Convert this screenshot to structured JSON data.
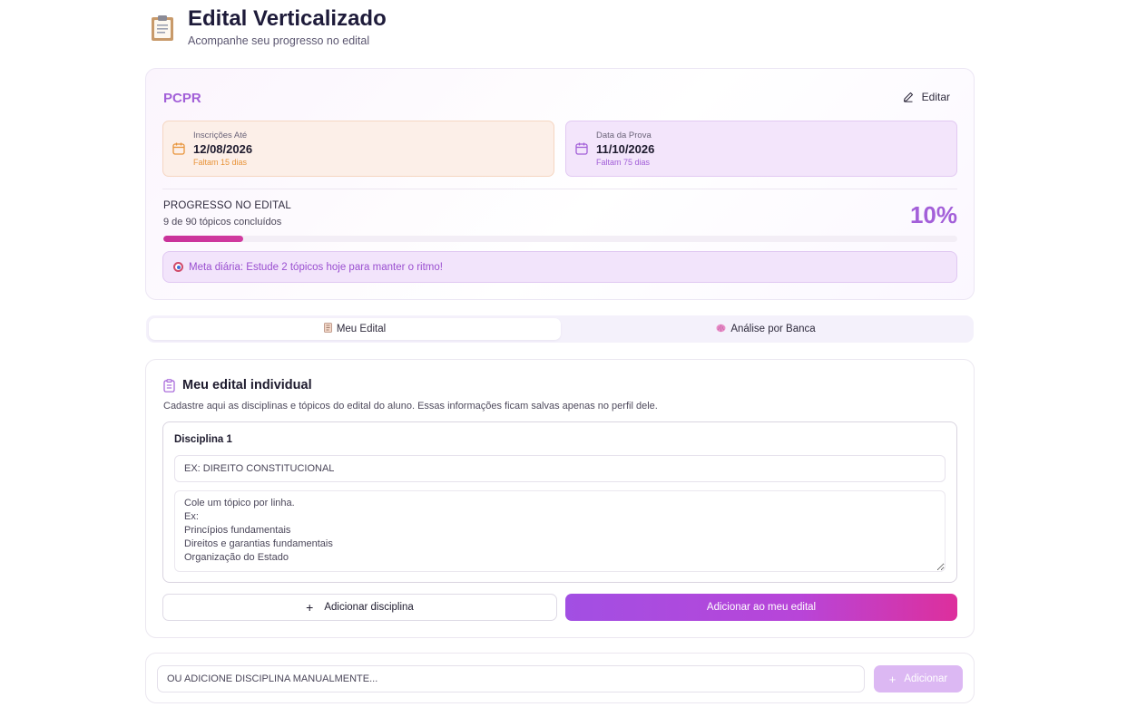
{
  "header": {
    "title": "Edital Verticalizado",
    "subtitle": "Acompanhe seu progresso no edital",
    "icon": "clipboard-icon"
  },
  "summary": {
    "exam_name": "PCPR",
    "edit_label": "Editar",
    "inscricoes": {
      "label": "Inscrições Até",
      "date": "12/08/2026",
      "remaining": "Faltam 15 dias"
    },
    "prova": {
      "label": "Data da Prova",
      "date": "11/10/2026",
      "remaining": "Faltam 75 dias"
    },
    "progress": {
      "label": "PROGRESSO NO EDITAL",
      "detail": "9 de 90 tópicos concluídos",
      "percent_text": "10%",
      "fraction": 0.1
    },
    "daily_goal": "Meta diária: Estude 2 tópicos hoje para manter o ritmo!"
  },
  "tabs": [
    {
      "label": "Meu Edital",
      "icon": "book-icon",
      "active": true
    },
    {
      "label": "Análise por Banca",
      "icon": "brain-icon",
      "active": false
    }
  ],
  "edital": {
    "title": "Meu edital individual",
    "description": "Cadastre aqui as disciplinas e tópicos do edital do aluno. Essas informações ficam salvas apenas no perfil dele.",
    "disciplina_label": "Disciplina 1",
    "name_placeholder": "EX: DIREITO CONSTITUCIONAL",
    "topics_placeholder": "Cole um tópico por linha.\nEx:\nPrincípios fundamentais\nDireitos e garantias fundamentais\nOrganização do Estado",
    "add_discipline_label": "Adicionar disciplina",
    "add_to_edital_label": "Adicionar ao meu edital"
  },
  "manual": {
    "placeholder": "OU ADICIONE DISCIPLINA MANUALMENTE...",
    "button_label": "Adicionar"
  },
  "colors": {
    "accent_purple": "#a35fd9",
    "accent_pink": "#dd2f9c",
    "insc_bg": "#fcefe8",
    "prova_bg": "#f3e5fb"
  }
}
